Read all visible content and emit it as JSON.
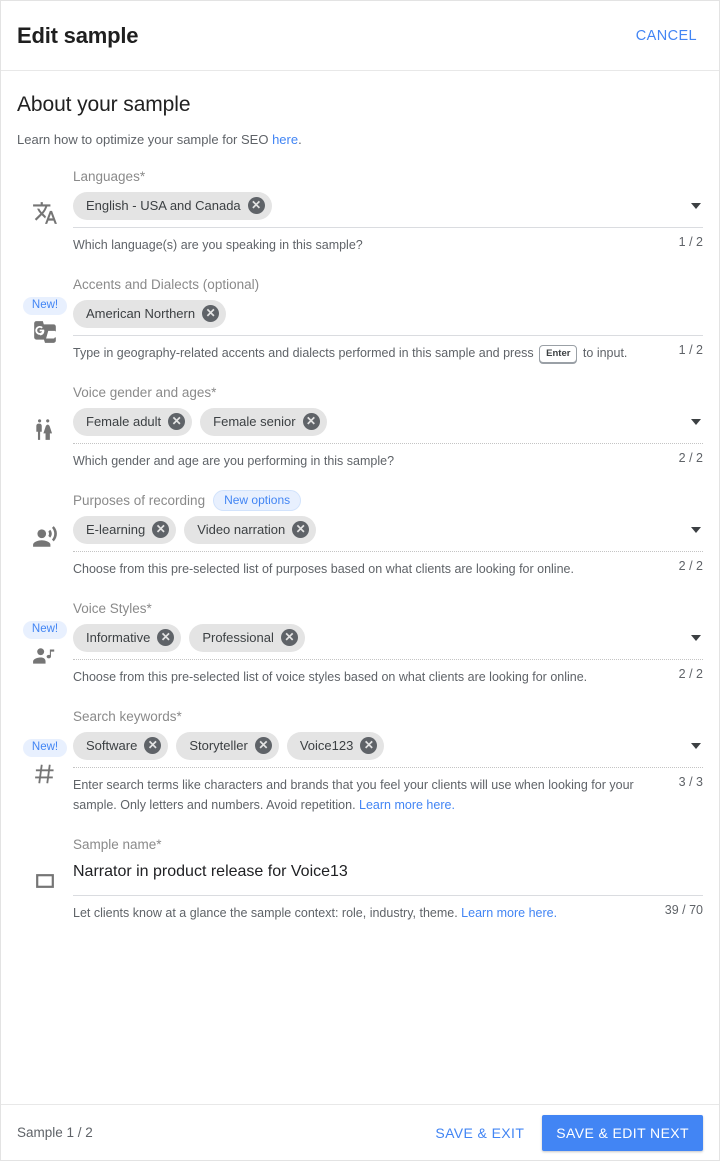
{
  "header": {
    "title": "Edit sample",
    "cancel_label": "CANCEL"
  },
  "intro": {
    "heading": "About your sample",
    "text_before_link": "Learn how to optimize your sample for SEO ",
    "link_label": "here",
    "text_after_link": "."
  },
  "fields": [
    {
      "icon": "translate-icon",
      "new_badge": null,
      "label": "Languages*",
      "label_pill": null,
      "chips": [
        "English - USA and Canada"
      ],
      "underline": "solid",
      "has_caret": true,
      "helper": "Which language(s) are you speaking in this sample?",
      "counter": "1 / 2"
    },
    {
      "icon": "g-translate-icon",
      "new_badge": "New!",
      "label": "Accents and Dialects (optional)",
      "label_pill": null,
      "chips": [
        "American Northern"
      ],
      "underline": "solid",
      "has_caret": false,
      "helper_part1": "Type in geography-related accents and dialects performed in this sample and press ",
      "helper_key": "Enter",
      "helper_part2": " to input.",
      "counter": "1 / 2"
    },
    {
      "icon": "wc-icon",
      "new_badge": null,
      "label": "Voice gender and ages*",
      "label_pill": null,
      "chips": [
        "Female adult",
        "Female senior"
      ],
      "underline": "dotted",
      "has_caret": true,
      "helper": "Which gender and age are you performing in this sample?",
      "counter": "2 / 2"
    },
    {
      "icon": "record-voice-over-icon",
      "new_badge": null,
      "label": "Purposes of recording",
      "label_pill": "New options",
      "chips": [
        "E-learning",
        "Video narration"
      ],
      "underline": "dotted",
      "has_caret": true,
      "helper": "Choose from this pre-selected list of purposes based on what clients are looking for online.",
      "counter": "2 / 2"
    },
    {
      "icon": "person-music-icon",
      "new_badge": "New!",
      "label": "Voice Styles*",
      "label_pill": null,
      "chips": [
        "Informative",
        "Professional"
      ],
      "underline": "dotted",
      "has_caret": true,
      "helper": "Choose from this pre-selected list of voice styles based on what clients are looking for online.",
      "counter": "2 / 2"
    },
    {
      "icon": "hash-icon",
      "new_badge": "New!",
      "label": "Search keywords*",
      "label_pill": null,
      "chips": [
        "Software",
        "Storyteller",
        "Voice123"
      ],
      "underline": "dotted",
      "has_caret": true,
      "helper_part1": "Enter search terms like characters and brands that you feel your clients will use when looking for your sample. Only letters and numbers. Avoid repetition. ",
      "helper_link": "Learn more here.",
      "counter": "3 / 3"
    },
    {
      "icon": "crop-square-icon",
      "new_badge": null,
      "label": "Sample name*",
      "label_pill": null,
      "value": "Narrator in product release for Voice13",
      "underline": "solid",
      "has_caret": false,
      "helper_part1": "Let clients know at a glance the sample context: role, industry, theme. ",
      "helper_link": "Learn more here.",
      "counter": "39 / 70"
    }
  ],
  "footer": {
    "status": "Sample 1 / 2",
    "save_exit_label": "SAVE & EXIT",
    "save_next_label": "SAVE & EDIT NEXT"
  },
  "colors": {
    "accent": "#4285f4",
    "chip_bg": "#e4e4e4",
    "badge_bg": "#e8f0fe",
    "text": "#3c4043"
  }
}
